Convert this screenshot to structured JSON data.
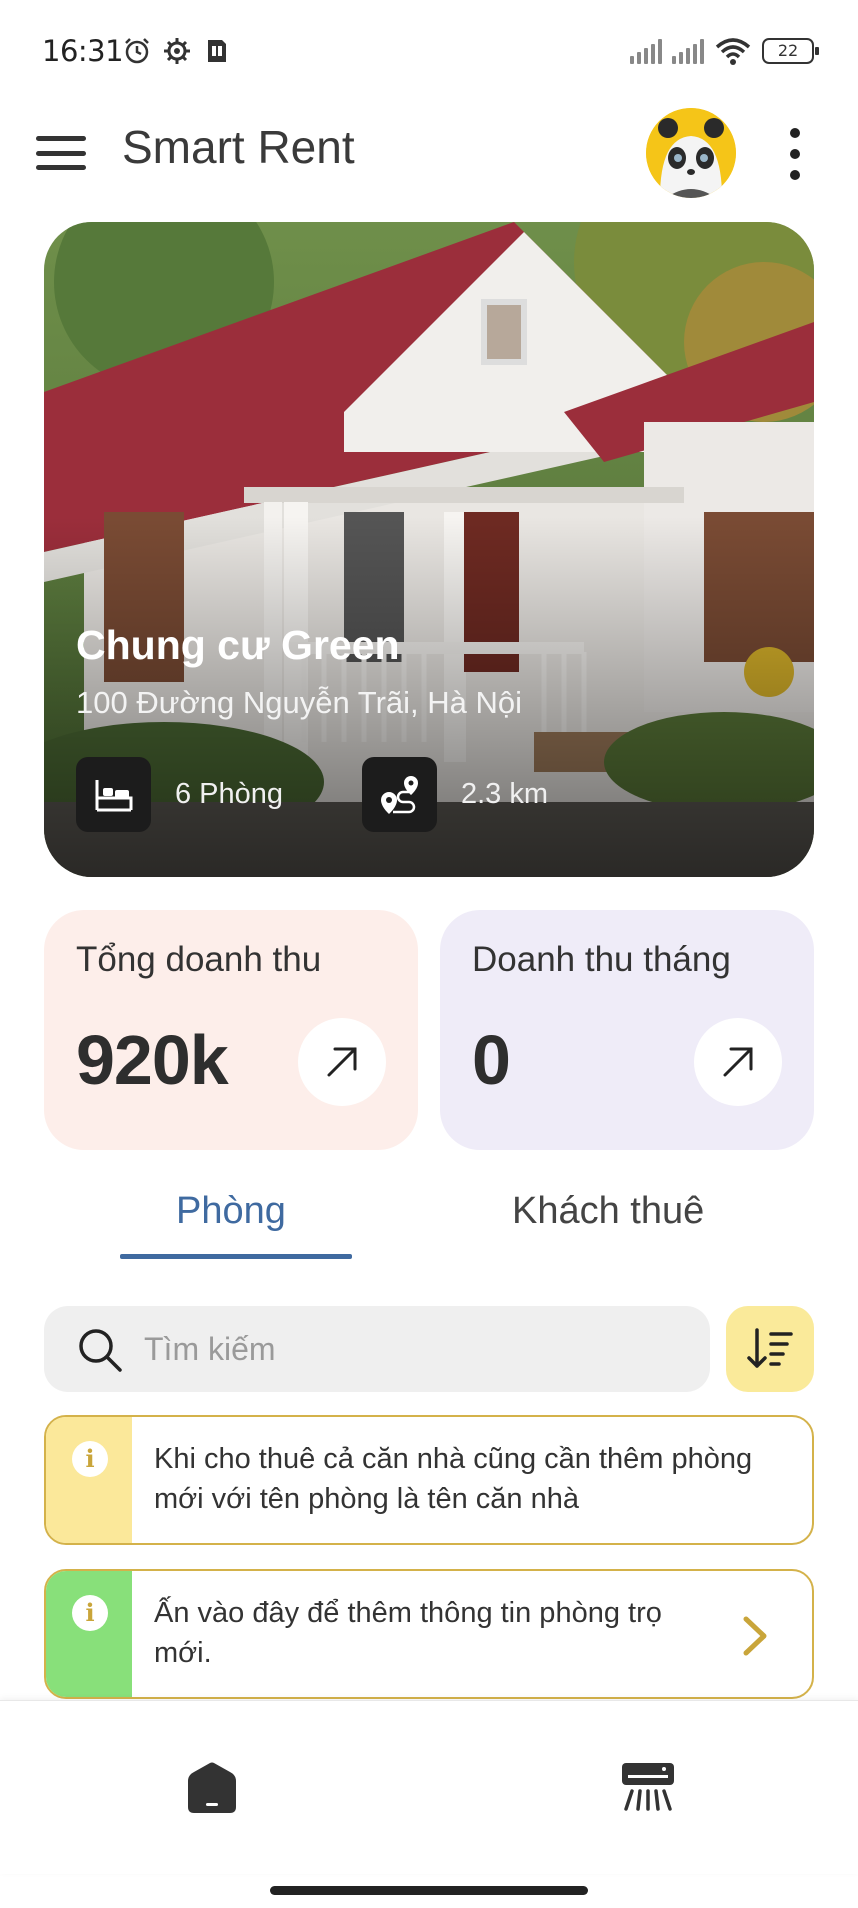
{
  "status_bar": {
    "time": "16:31",
    "battery": "22"
  },
  "app_bar": {
    "title": "Smart Rent"
  },
  "hero": {
    "title": "Chung cư Green",
    "address": "100 Đường Nguyễn Trãi, Hà Nội",
    "rooms": "6 Phòng",
    "distance": "2.3 km"
  },
  "stats": [
    {
      "label": "Tổng doanh thu",
      "value": "920k",
      "color": "#fdeeea"
    },
    {
      "label": "Doanh thu tháng",
      "value": "0",
      "color": "#efecf8"
    }
  ],
  "tabs": [
    {
      "label": "Phòng",
      "active": true,
      "color": "#3f6aa0"
    },
    {
      "label": "Khách thuê",
      "active": false,
      "color": "#444444"
    }
  ],
  "search": {
    "placeholder": "Tìm kiếm",
    "value": ""
  },
  "notices": [
    {
      "text": "Khi cho thuê cả căn nhà cũng cần thêm phòng mới với tên phòng là tên căn nhà",
      "strip_color": "#fbe89a"
    },
    {
      "text": "Ấn vào đây để thêm thông tin phòng trọ mới.",
      "strip_color": "#88e07a"
    }
  ],
  "icons": {
    "info": "i"
  },
  "colors": {
    "accent": "#3f6aa0",
    "sort_button": "#faea9a",
    "notice_border": "#d4b24a"
  }
}
